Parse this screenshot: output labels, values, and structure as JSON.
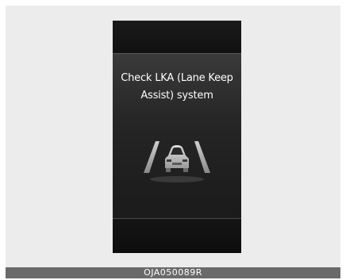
{
  "cluster_display": {
    "message_line1": "Check LKA (Lane Keep",
    "message_line2": "Assist) system",
    "icon": "lane-keep-assist-car-icon"
  },
  "caption": {
    "code": "OJA050089R"
  }
}
